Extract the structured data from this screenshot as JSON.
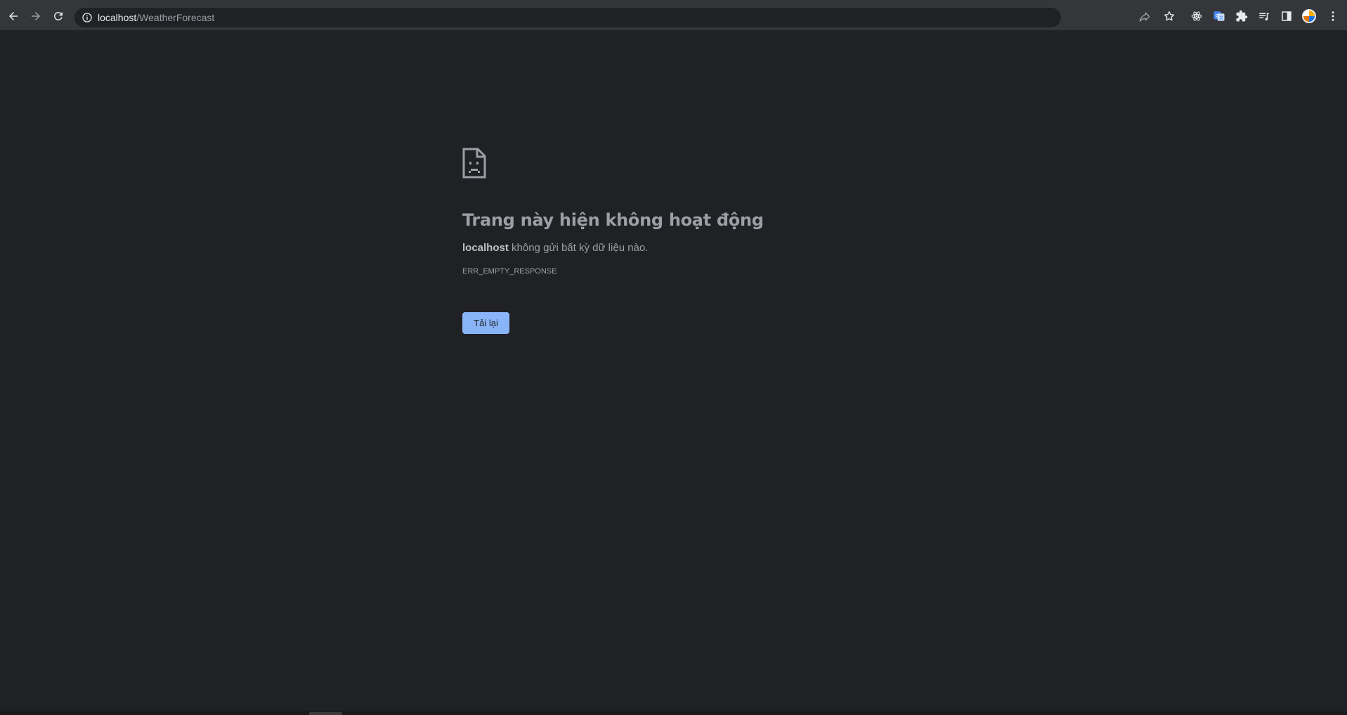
{
  "browser": {
    "back_icon": "arrow-left-icon",
    "forward_icon": "arrow-right-icon",
    "reload_icon": "reload-icon",
    "address": {
      "host": "localhost",
      "path": "/WeatherForecast"
    },
    "extensions": [
      "react-devtools-icon",
      "google-translate-icon",
      "puzzle-icon",
      "reading-list-icon",
      "side-panel-icon"
    ],
    "accent_color": "#8ab4f8"
  },
  "error_page": {
    "title": "Trang này hiện không hoạt động",
    "host": "localhost",
    "description": " không gửi bất kỳ dữ liệu nào.",
    "error_code": "ERR_EMPTY_RESPONSE",
    "reload_label": "Tải lại"
  }
}
